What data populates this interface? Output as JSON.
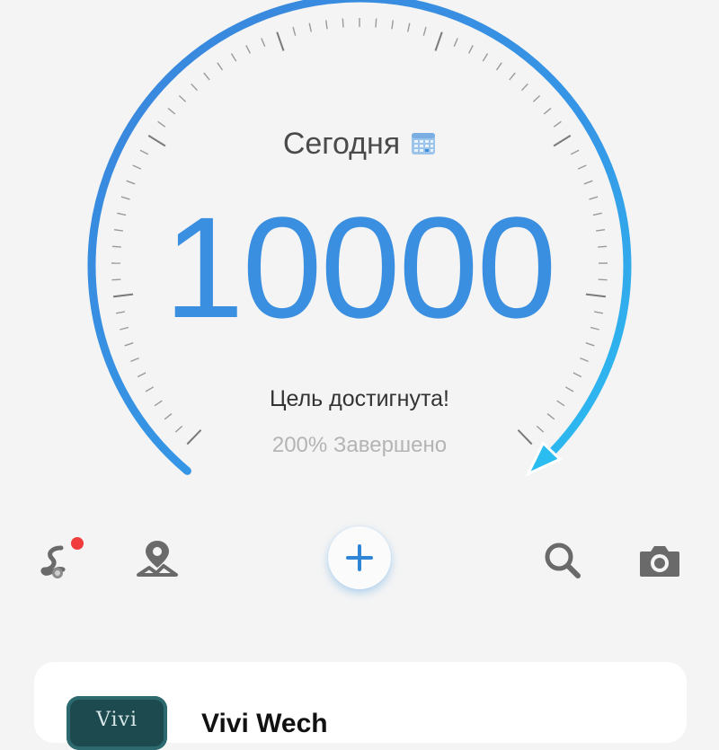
{
  "gauge": {
    "progress_percent": 200,
    "track_color": "#3a8fe0",
    "gradient_end_color": "#2bc0f2"
  },
  "date": {
    "label": "Сегодня",
    "icon": "calendar-icon"
  },
  "steps": {
    "count": "10000"
  },
  "goal": {
    "status": "Цель достигнута!",
    "completion": "200% Завершено"
  },
  "toolbar": {
    "route_icon": "route-icon",
    "map_icon": "map-pin-icon",
    "add_icon": "plus-icon",
    "search_icon": "search-icon",
    "camera_icon": "camera-icon",
    "notification_color": "#f03c3c"
  },
  "card": {
    "thumb_label": "Vivi",
    "title": "Vivi Wech"
  }
}
